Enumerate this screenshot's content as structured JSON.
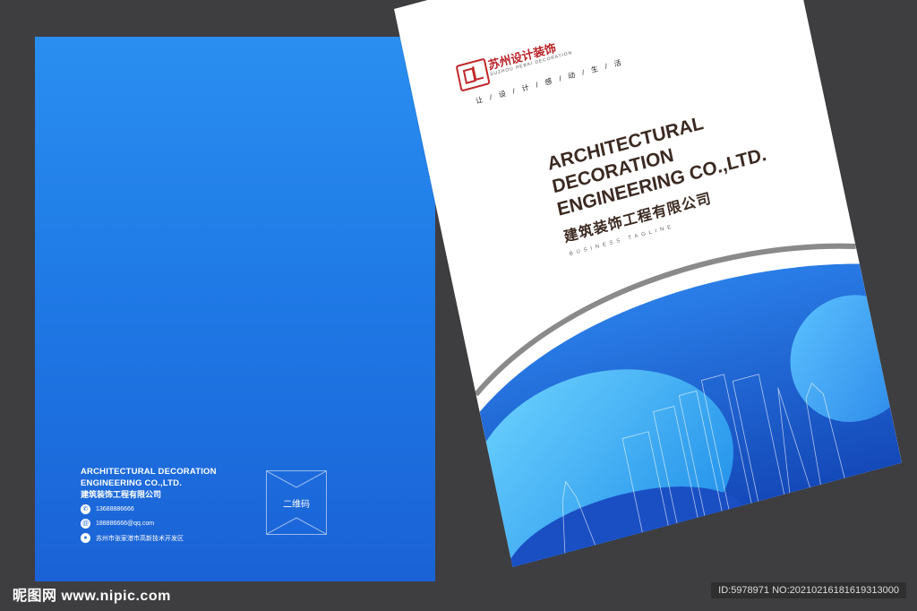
{
  "back_cover": {
    "company_en_line1": "ARCHITECTURAL DECORATION",
    "company_en_line2": "ENGINEERING CO.,LTD.",
    "company_cn": "建筑装饰工程有限公司",
    "phone": "13688886666",
    "email": "188886666@qq.com",
    "address": "苏州市张家港市高新技术开发区",
    "qr_label": "二维码",
    "color": "#1f7ae6"
  },
  "front_cover": {
    "brand_cn": "苏州设计装饰",
    "brand_en": "SUZHOU HEBAI DECORATION",
    "slogan": "让 / 设 / 计 / 感 / 动 / 生 / 活",
    "title": "ARCHITECTURAL\nDECORATION\nENGINEERING CO.,LTD.",
    "title_cn": "建筑装饰工程有限公司",
    "tagline": "BUSINESS TAGLINE",
    "accent_color": "#1a5fd6",
    "brand_color": "#b82328"
  },
  "footer": {
    "site_logo": "昵图网 www.nipic.com",
    "image_id": "ID:5978971 NO:20210216181619313000"
  }
}
